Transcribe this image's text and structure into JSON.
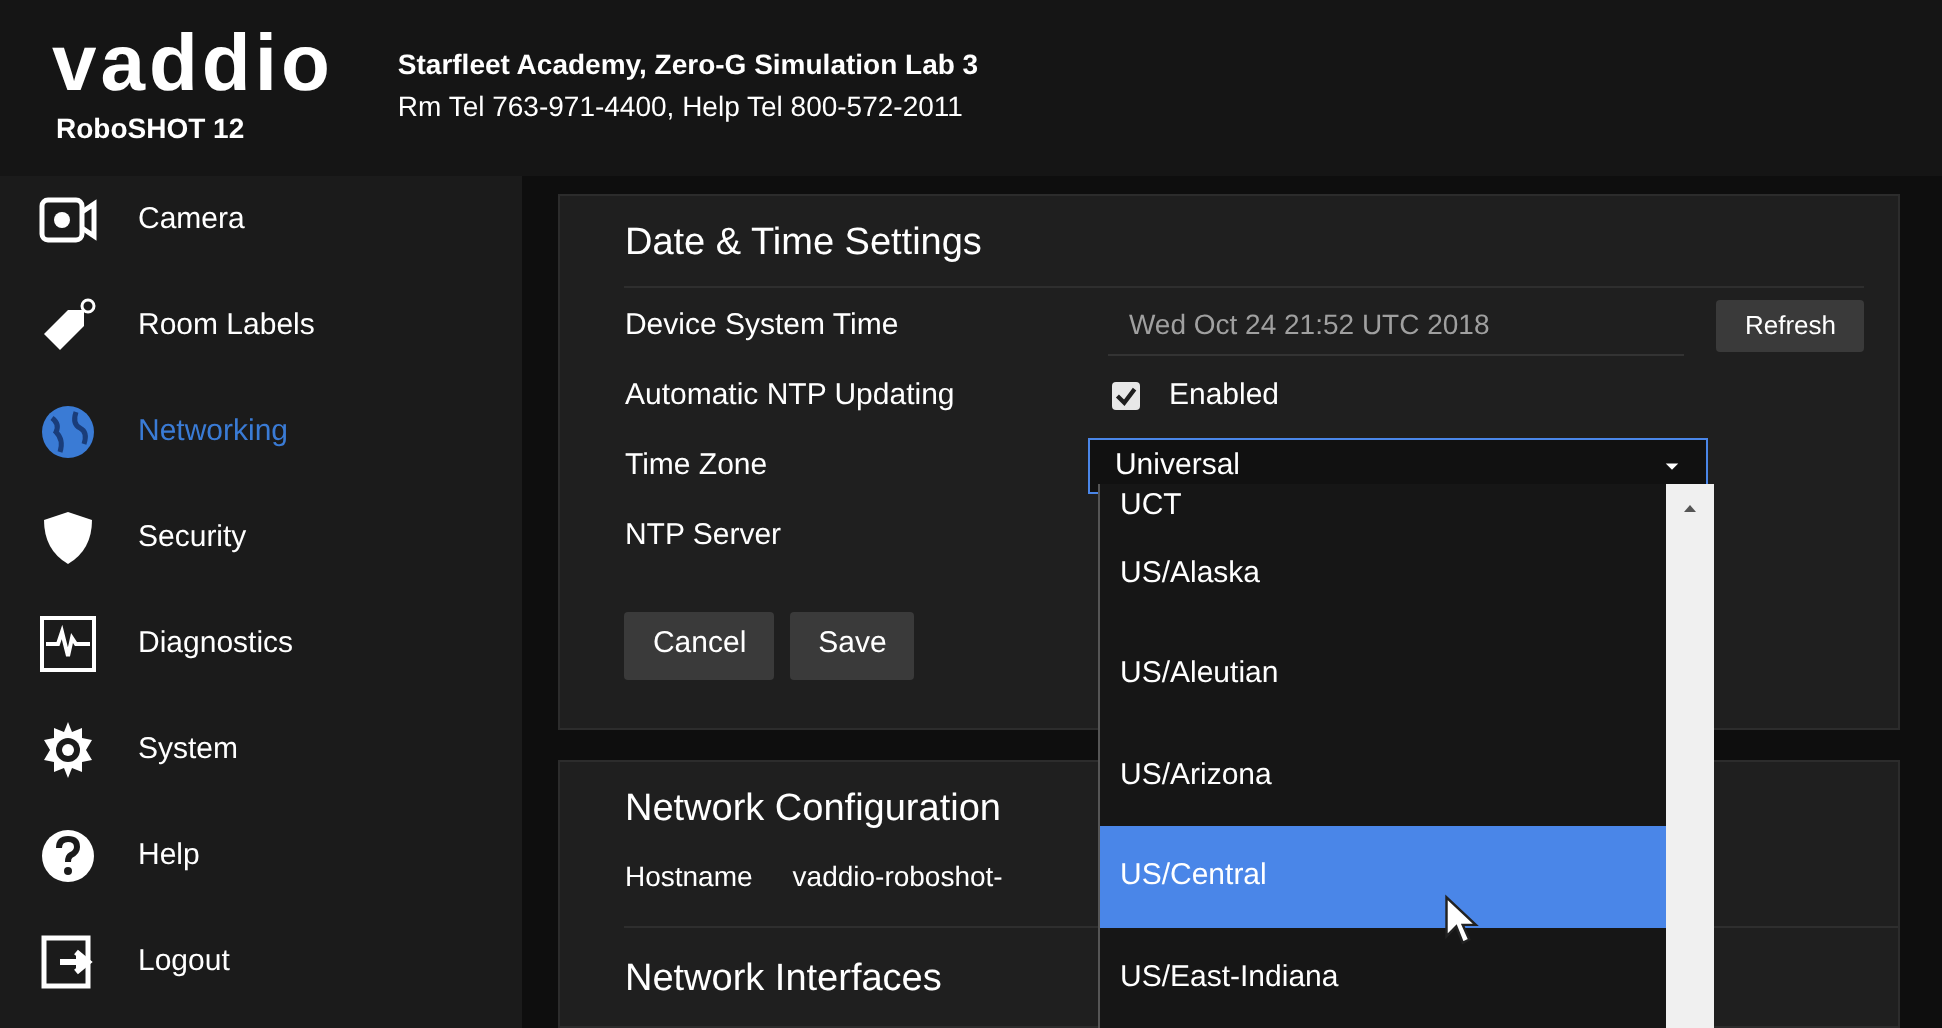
{
  "header": {
    "logo": "vaddio",
    "product": "RoboSHOT 12",
    "location": "Starfleet Academy, Zero-G Simulation Lab 3",
    "contact": "Rm Tel 763-971-4400, Help Tel 800-572-2011"
  },
  "sidebar": {
    "items": [
      {
        "label": "Camera",
        "selected": false
      },
      {
        "label": "Room Labels",
        "selected": false
      },
      {
        "label": "Networking",
        "selected": true
      },
      {
        "label": "Security",
        "selected": false
      },
      {
        "label": "Diagnostics",
        "selected": false
      },
      {
        "label": "System",
        "selected": false
      },
      {
        "label": "Help",
        "selected": false
      },
      {
        "label": "Logout",
        "selected": false
      }
    ]
  },
  "date_time": {
    "title": "Date & Time Settings",
    "system_time": {
      "label": "Device System Time",
      "value": "Wed Oct 24 21:52 UTC 2018",
      "button": "Refresh"
    },
    "ntp_updating": {
      "label": "Automatic NTP Updating",
      "checked": true,
      "text": "Enabled"
    },
    "time_zone": {
      "label": "Time Zone",
      "value": "Universal"
    },
    "ntp_server": {
      "label": "NTP Server"
    },
    "buttons": [
      "Cancel",
      "Save"
    ]
  },
  "time_zone_options": [
    {
      "label": "UCT",
      "selected": false
    },
    {
      "label": "US/Alaska",
      "selected": false
    },
    {
      "label": "US/Aleutian",
      "selected": false
    },
    {
      "label": "US/Arizona",
      "selected": false
    },
    {
      "label": "US/Central",
      "selected": true
    },
    {
      "label": "US/East-Indiana",
      "selected": false
    }
  ],
  "network_configuration": {
    "title": "Network Configuration",
    "hostname": {
      "label": "Hostname",
      "value": "vaddio-roboshot-"
    }
  },
  "network_interfaces": {
    "title": "Network Interfaces"
  }
}
